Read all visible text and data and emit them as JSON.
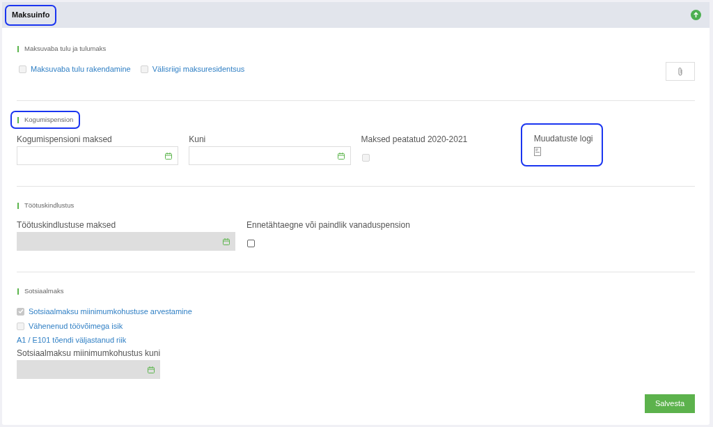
{
  "header": {
    "title": "Maksuinfo",
    "highlighted": true
  },
  "sections": [
    {
      "title": "Maksuvaba tulu ja tulumaks",
      "highlighted": false,
      "kind": "row",
      "fields": [
        {
          "kind": "inline-checkbox",
          "label": "Maksuvaba tulu rakendamine",
          "checked": false,
          "disabled": true
        },
        {
          "kind": "inline-checkbox",
          "label": "Välisriigi maksuresidentsus",
          "checked": false,
          "disabled": true
        },
        {
          "kind": "attach"
        }
      ]
    },
    {
      "title": "Kogumispension",
      "highlighted": true,
      "kind": "grid4",
      "fields": [
        {
          "kind": "date",
          "label": "Kogumispensioni maksed",
          "disabled": false
        },
        {
          "kind": "date",
          "label": "Kuni",
          "disabled": false
        },
        {
          "kind": "labeled-checkbox",
          "label": "Maksed peatatud 2020-2021",
          "checked": false,
          "disabled": true
        },
        {
          "kind": "log",
          "label": "Muudatuste logi",
          "highlighted": true
        }
      ]
    },
    {
      "title": "Töötuskindlustus",
      "highlighted": false,
      "kind": "grid3",
      "fields": [
        {
          "kind": "date",
          "label": "Töötuskindlustuse maksed",
          "disabled": true
        },
        {
          "kind": "labeled-checkbox",
          "label": "Ennetähtaegne või paindlik vanaduspension",
          "checked": false,
          "disabled": false
        }
      ]
    },
    {
      "title": "Sotsiaalmaks",
      "highlighted": false,
      "kind": "stack",
      "fields": [
        {
          "kind": "inline-checkbox",
          "label": "Sotsiaalmaksu miinimumkohustuse arvestamine",
          "checked": true,
          "disabled": true
        },
        {
          "kind": "inline-checkbox",
          "label": "Vähenenud töövõimega isik",
          "checked": false,
          "disabled": true
        },
        {
          "kind": "link",
          "label": "A1 / E101 tõendi väljastanud riik"
        },
        {
          "kind": "date",
          "label": "Sotsiaalmaksu miinimumkohustus kuni",
          "disabled": true
        }
      ]
    }
  ],
  "save_button": "Salvesta"
}
